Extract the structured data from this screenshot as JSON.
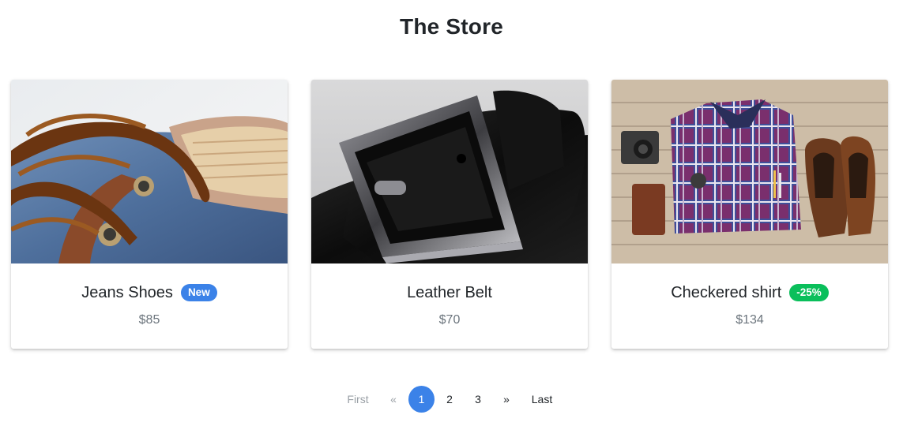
{
  "store": {
    "title": "The Store"
  },
  "products": [
    {
      "name": "Jeans Shoes",
      "badge": "New",
      "badge_color": "#3b82e8",
      "price": "$85",
      "image": "shoe-lace-photo"
    },
    {
      "name": "Leather Belt",
      "badge": "",
      "price": "$70",
      "image": "leather-belt-photo"
    },
    {
      "name": "Checkered shirt",
      "badge": "-25%",
      "badge_color": "#0abf5b",
      "price": "$134",
      "image": "flat-lay-shirt-photo"
    }
  ],
  "pagination": {
    "first": "First",
    "prev": "«",
    "pages": [
      "1",
      "2",
      "3"
    ],
    "current": "1",
    "next": "»",
    "last": "Last",
    "active_color": "#3b82e8"
  }
}
